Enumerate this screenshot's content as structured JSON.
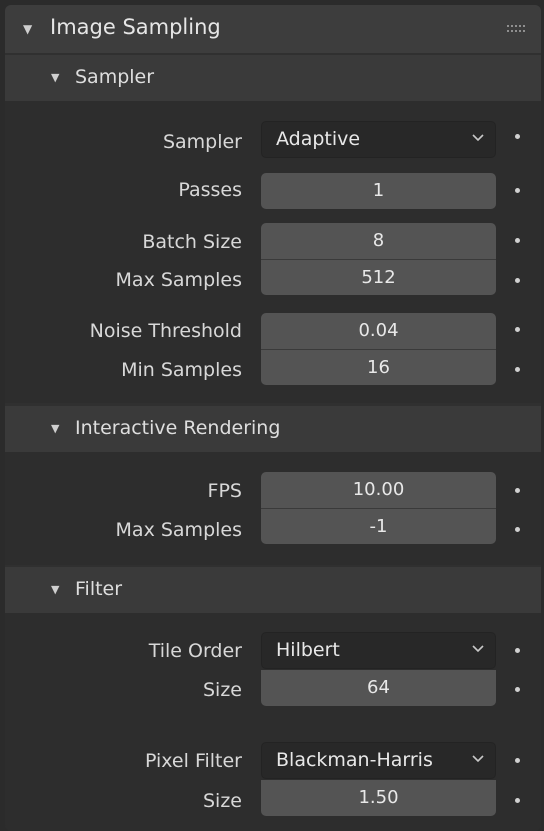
{
  "panel": {
    "title": "Image Sampling"
  },
  "sampler_section": {
    "title": "Sampler",
    "sampler_label": "Sampler",
    "sampler_value": "Adaptive",
    "passes_label": "Passes",
    "passes_value": "1",
    "batch_size_label": "Batch Size",
    "batch_size_value": "8",
    "max_samples_label": "Max Samples",
    "max_samples_value": "512",
    "noise_threshold_label": "Noise Threshold",
    "noise_threshold_value": "0.04",
    "min_samples_label": "Min Samples",
    "min_samples_value": "16"
  },
  "interactive_section": {
    "title": "Interactive Rendering",
    "fps_label": "FPS",
    "fps_value": "10.00",
    "max_samples_label": "Max Samples",
    "max_samples_value": "-1"
  },
  "filter_section": {
    "title": "Filter",
    "tile_order_label": "Tile Order",
    "tile_order_value": "Hilbert",
    "tile_size_label": "Size",
    "tile_size_value": "64",
    "pixel_filter_label": "Pixel Filter",
    "pixel_filter_value": "Blackman-Harris",
    "filter_size_label": "Size",
    "filter_size_value": "1.50"
  }
}
